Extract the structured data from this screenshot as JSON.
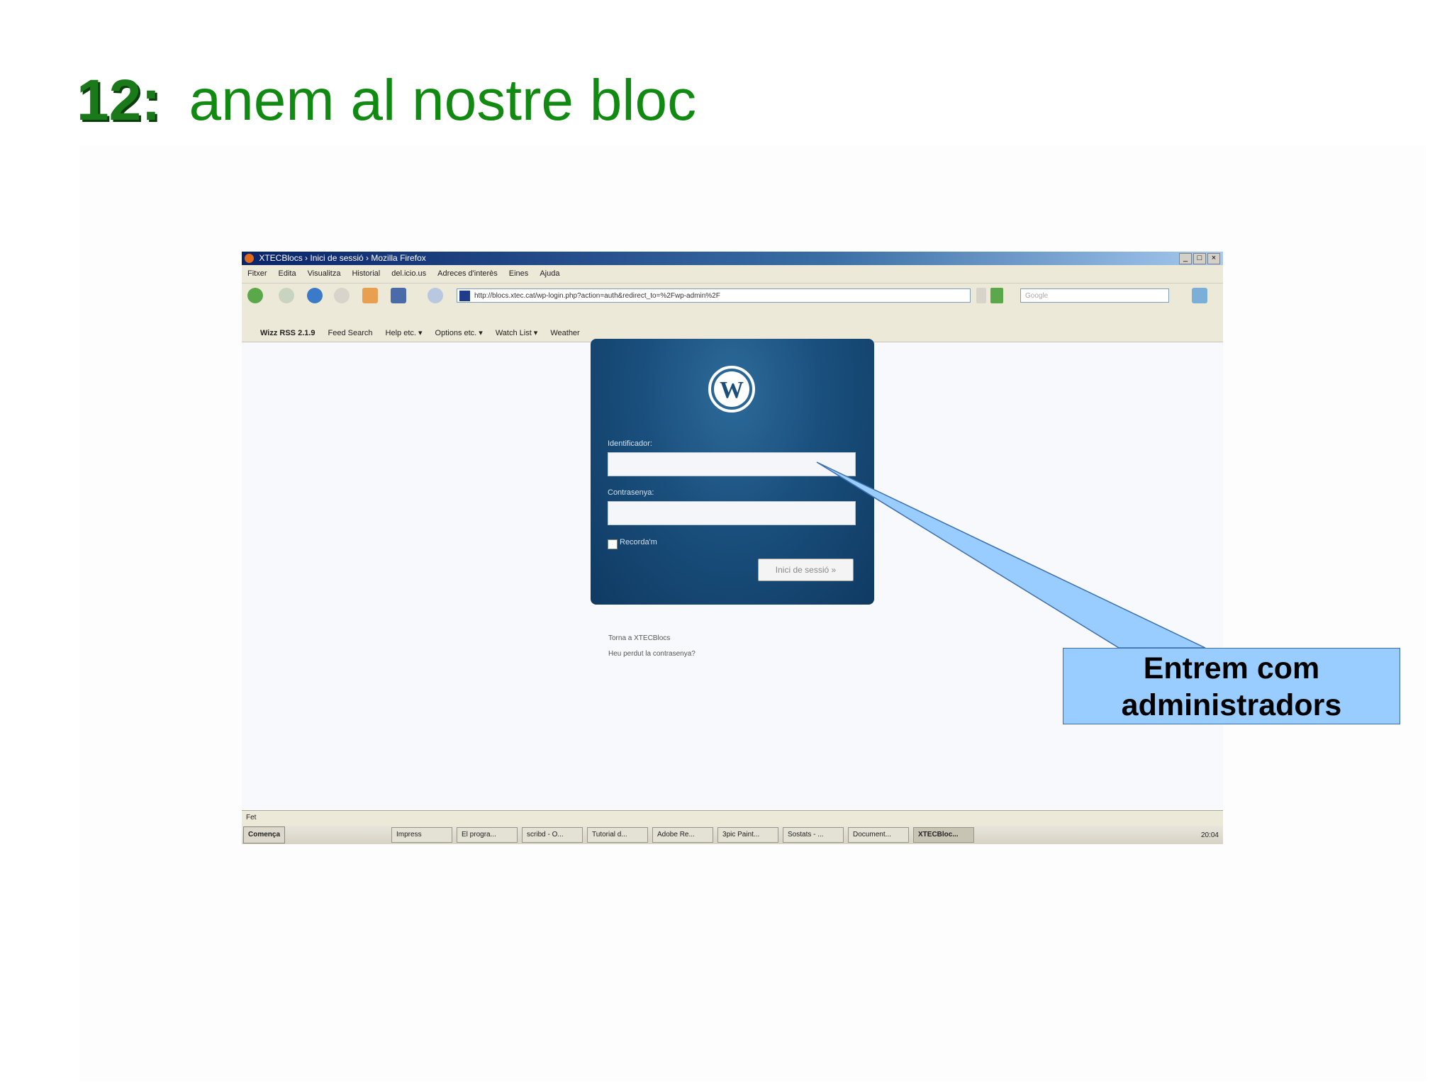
{
  "slide": {
    "number": "12:",
    "title": "anem al nostre bloc"
  },
  "browser": {
    "window_title": "XTECBlocs › Inici de sessió › Mozilla Firefox",
    "menu": [
      "Fitxer",
      "Edita",
      "Visualitza",
      "Historial",
      "del.icio.us",
      "Adreces d'interès",
      "Eines",
      "Ajuda"
    ],
    "url": "http://blocs.xtec.cat/wp-login.php?action=auth&redirect_to=%2Fwp-admin%2F",
    "search_placeholder": "Google",
    "rss_toolbar": {
      "title": "Wizz RSS 2.1.9",
      "items": [
        "Feed Search",
        "Help etc. ▾",
        "Options etc. ▾",
        "Watch List ▾",
        "Weather"
      ]
    },
    "status": "Fet"
  },
  "login": {
    "username_label": "Identificador:",
    "password_label": "Contrasenya:",
    "remember_label": "Recorda'm",
    "submit_label": "Inici de sessió »",
    "back_link": "Torna a XTECBlocs",
    "lost_password_link": "Heu perdut la contrasenya?"
  },
  "taskbar": {
    "start_label": "Comença",
    "tasks": [
      "Impress",
      "El progra...",
      "scribd - O...",
      "Tutorial d...",
      "Adobe Re...",
      "3pic Paint...",
      "Sostats - ...",
      "Document...",
      "XTECBloc..."
    ],
    "clock": "20:04"
  },
  "callout": {
    "line1": "Entrem com",
    "line2": "administradors",
    "fill_color": "#99ccff"
  },
  "colors": {
    "title_green": "#108a10",
    "login_panel": "#1a4f7d"
  }
}
